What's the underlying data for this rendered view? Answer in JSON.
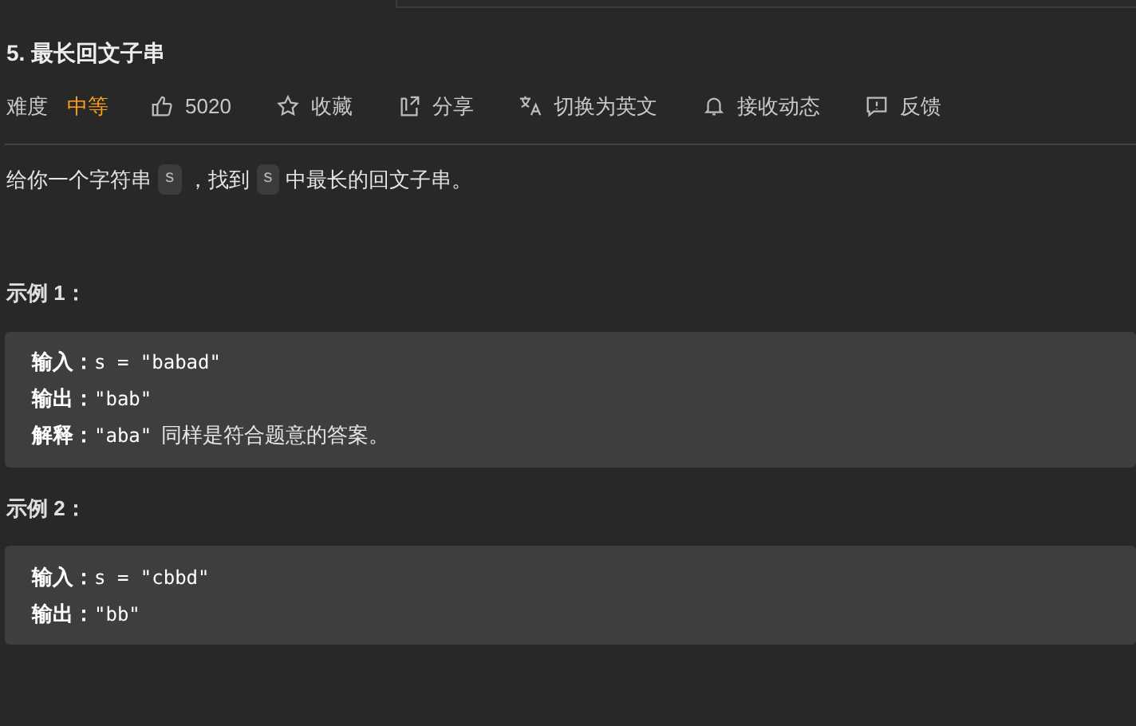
{
  "title": "5. 最长回文子串",
  "difficulty": {
    "label": "难度",
    "value": "中等"
  },
  "actions": [
    {
      "kind": "like",
      "label": "5020"
    },
    {
      "kind": "star",
      "label": "收藏"
    },
    {
      "kind": "share",
      "label": "分享"
    },
    {
      "kind": "translate",
      "label": "切换为英文"
    },
    {
      "kind": "bell",
      "label": "接收动态"
    },
    {
      "kind": "feedback",
      "label": "反馈"
    }
  ],
  "description": [
    {
      "kind": "text",
      "text": "给你一个字符串"
    },
    {
      "kind": "code",
      "text": "s"
    },
    {
      "kind": "text",
      "text": "，找到"
    },
    {
      "kind": "code",
      "text": "s"
    },
    {
      "kind": "text",
      "text": "中最长的回文子串。"
    }
  ],
  "examples": [
    {
      "heading": "示例 1：",
      "lines": [
        {
          "label": "输入：",
          "value": "s = \"babad\""
        },
        {
          "label": "输出：",
          "value": "\"bab\""
        },
        {
          "label": "解释：",
          "value": "\"aba\"",
          "note": "同样是符合题意的答案。"
        }
      ]
    },
    {
      "heading": "示例 2：",
      "lines": [
        {
          "label": "输入：",
          "value": "s = \"cbbd\""
        },
        {
          "label": "输出：",
          "value": "\"bb\""
        }
      ]
    }
  ]
}
